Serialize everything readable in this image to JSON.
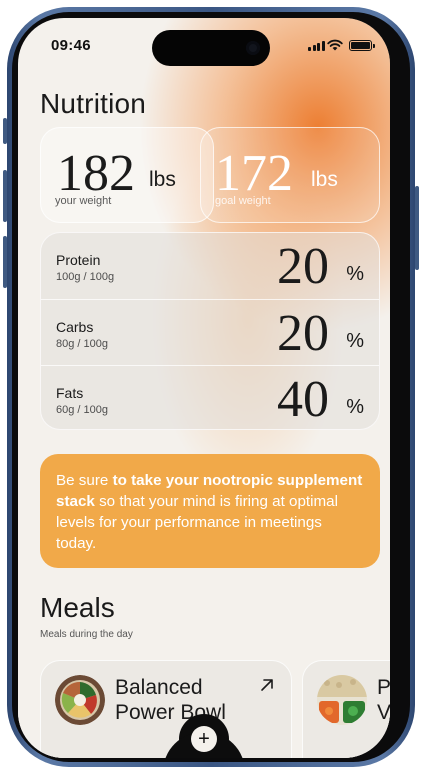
{
  "status": {
    "time": "09:46"
  },
  "page": {
    "title": "Nutrition"
  },
  "weights": {
    "current": {
      "value": "182",
      "unit": "lbs",
      "caption": "your weight"
    },
    "goal": {
      "value": "172",
      "unit": "lbs",
      "caption": "goal weight"
    }
  },
  "macros": [
    {
      "name": "Protein",
      "amount": "100g / 100g",
      "percent": "20",
      "sign": "%"
    },
    {
      "name": "Carbs",
      "amount": "80g / 100g",
      "percent": "20",
      "sign": "%"
    },
    {
      "name": "Fats",
      "amount": "60g / 100g",
      "percent": "40",
      "sign": "%"
    }
  ],
  "callout": {
    "lead": "Be sure ",
    "emphasis": "to take your nootropic supplement stack",
    "rest": " so that your mind is firing at optimal levels for your performance in meetings today."
  },
  "meals_section": {
    "title": "Meals",
    "subtitle": "Meals during the day"
  },
  "meals": [
    {
      "name_line1": "Balanced",
      "name_line2": "Power Bowl",
      "icon": "bowl-photo"
    },
    {
      "name_line1": "Pr",
      "name_line2": "Ve",
      "icon": "veggies-photo"
    }
  ],
  "colors": {
    "accent_orange": "#f1a949",
    "glow": "#ec7828",
    "background": "#f4f1ec",
    "text_dark": "#1a1a1a"
  }
}
